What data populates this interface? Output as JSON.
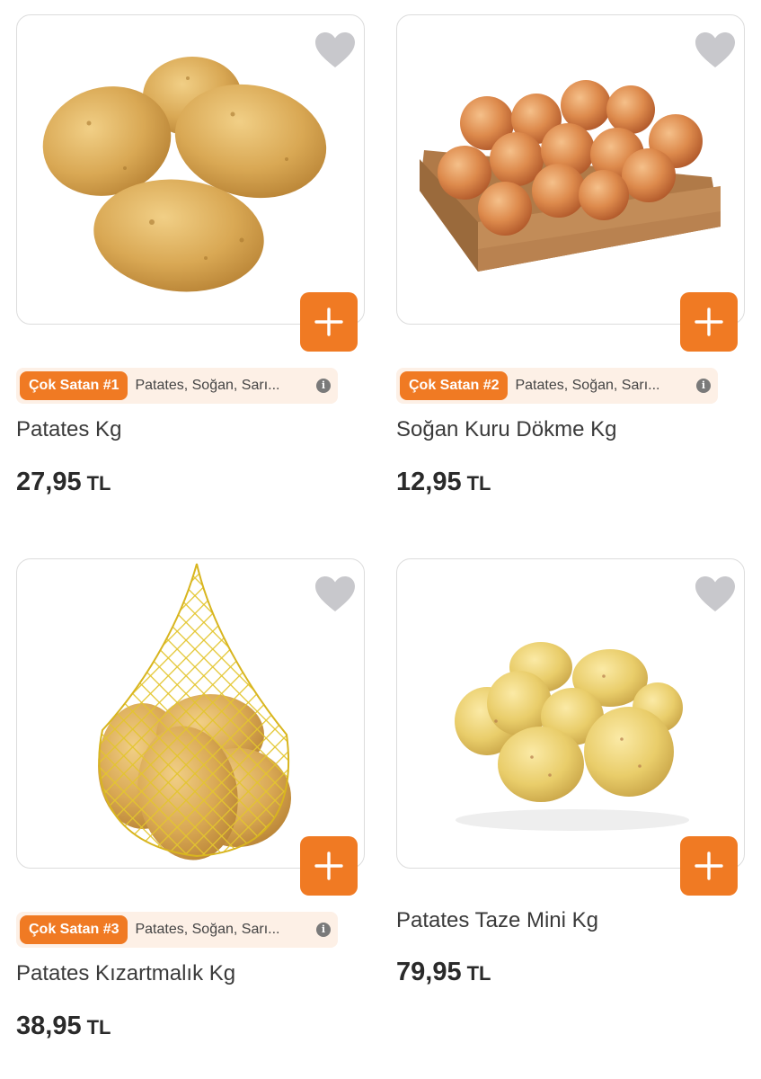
{
  "products": [
    {
      "name": "Patates Kg",
      "badge": "Çok Satan #1",
      "categories": "Patates, Soğan, Sarı...",
      "price": "27,95",
      "currency": "TL",
      "image": "potatoes-image"
    },
    {
      "name": "Soğan Kuru Dökme Kg",
      "badge": "Çok Satan #2",
      "categories": "Patates, Soğan, Sarı...",
      "price": "12,95",
      "currency": "TL",
      "image": "onions-crate-image"
    },
    {
      "name": "Patates Kızartmalık Kg",
      "badge": "Çok Satan #3",
      "categories": "Patates, Soğan, Sarı...",
      "price": "38,95",
      "currency": "TL",
      "image": "potatoes-net-image"
    },
    {
      "name": "Patates Taze Mini Kg",
      "badge": "",
      "categories": "",
      "price": "79,95",
      "currency": "TL",
      "image": "mini-potatoes-image"
    }
  ],
  "colors": {
    "accent": "#f07a23",
    "badge_bg": "#fdf0e6",
    "heart": "#c8c8cc",
    "border": "#dcdcdc"
  },
  "icons": {
    "favorite": "heart-icon",
    "add": "plus-icon",
    "info": "info-icon"
  }
}
